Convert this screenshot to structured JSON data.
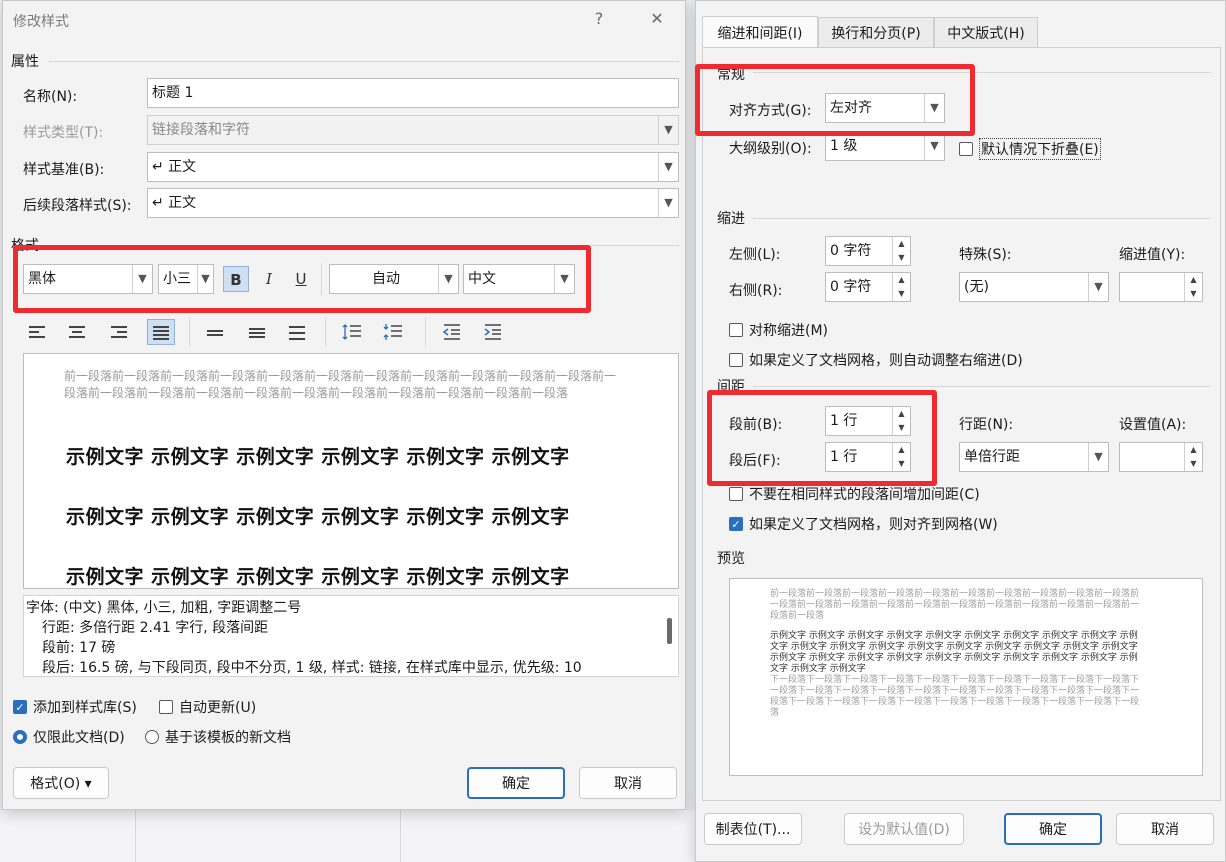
{
  "left_dialog": {
    "title": "修改样式",
    "help": "?",
    "close": "✕",
    "properties": {
      "section": "属性",
      "name_label": "名称(N):",
      "name_value": "标题 1",
      "type_label": "样式类型(T):",
      "type_value": "链接段落和字符",
      "based_on_label": "样式基准(B):",
      "based_on_value": "↵ 正文",
      "following_label": "后续段落样式(S):",
      "following_value": "↵ 正文"
    },
    "format": {
      "section": "格式",
      "font": "黑体",
      "size": "小三",
      "bold": "B",
      "italic": "I",
      "underline": "U",
      "color": "自动",
      "lang": "中文"
    },
    "preview": {
      "ghost_text": "前一段落前一段落前一段落前一段落前一段落前一段落前一段落前一段落前一段落前一段落前一段落前一段落前一段落前一段落前一段落前一段落前一段落前一段落前一段落前一段落前一段落前一段落",
      "sample_line": "示例文字 示例文字 示例文字 示例文字 示例文字 示例文字"
    },
    "description": [
      "字体: (中文) 黑体, 小三, 加粗, 字距调整二号",
      "行距: 多倍行距 2.41 字行, 段落间距",
      "段前: 17 磅",
      "段后: 16.5 磅, 与下段同页, 段中不分页, 1 级, 样式: 链接, 在样式库中显示, 优先级: 10"
    ],
    "add_to_gallery": "添加到样式库(S)",
    "auto_update": "自动更新(U)",
    "only_this_doc": "仅限此文档(D)",
    "new_docs_template": "基于该模板的新文档",
    "format_button": "格式(O) ▾",
    "ok": "确定",
    "cancel": "取消"
  },
  "right_dialog": {
    "tabs": [
      "缩进和间距(I)",
      "换行和分页(P)",
      "中文版式(H)"
    ],
    "general": {
      "section": "常规",
      "alignment_label": "对齐方式(G):",
      "alignment_value": "左对齐",
      "outline_label": "大纲级别(O):",
      "outline_value": "1 级",
      "collapse_label": "默认情况下折叠(E)"
    },
    "indent": {
      "section": "缩进",
      "left_label": "左侧(L):",
      "left_value": "0 字符",
      "right_label": "右侧(R):",
      "right_value": "0 字符",
      "special_label": "特殊(S):",
      "special_value": "(无)",
      "by_label": "缩进值(Y):",
      "mirror": "对称缩进(M)",
      "auto_adjust": "如果定义了文档网格，则自动调整右缩进(D)"
    },
    "spacing": {
      "section": "间距",
      "before_label": "段前(B):",
      "before_value": "1 行",
      "after_label": "段后(F):",
      "after_value": "1 行",
      "line_label": "行距(N):",
      "line_value": "单倍行距",
      "at_label": "设置值(A):",
      "no_space": "不要在相同样式的段落间增加间距(C)",
      "snap_grid": "如果定义了文档网格，则对齐到网格(W)"
    },
    "preview": {
      "section": "预览",
      "prev_para": "前一段落前一段落前一段落前一段落前一段落前一段落前一段落前一段落前一段落前一段落前一段落前一段落前一段落前一段落前一段落前一段落前一段落前一段落前一段落前一段落前一段落前一段落",
      "sample": "示例文字 示例文字 示例文字 示例文字 示例文字 示例文字 示例文字 示例文字 示例文字 示例文字 示例文字 示例文字 示例文字 示例文字 示例文字 示例文字 示例文字 示例文字 示例文字 示例文字 示例文字 示例文字 示例文字 示例文字 示例文字 示例文字 示例文字 示例文字 示例文字 示例文字 示例文字",
      "next_para": "下一段落下一段落下一段落下一段落下一段落下一段落下一段落下一段落下一段落下一段落下一段落下一段落下一段落下一段落下一段落下一段落下一段落下一段落下一段落下一段落下一段落下一段落下一段落下一段落下一段落下一段落下一段落下一段落下一段落下一段落下一段落"
    },
    "tabs_button": "制表位(T)...",
    "default_button": "设为默认值(D)",
    "ok": "确定",
    "cancel": "取消"
  },
  "colors": {
    "highlight": "#ee2b30",
    "accent": "#2a6fbe"
  }
}
